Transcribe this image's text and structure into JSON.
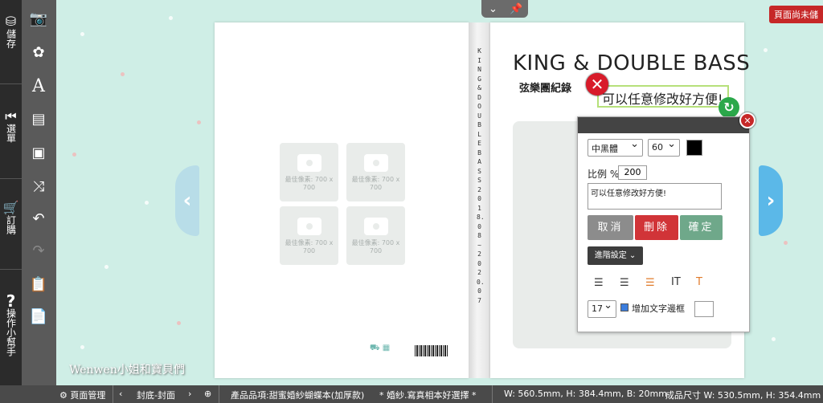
{
  "leftbar": {
    "save": "儲存",
    "menu": "選單",
    "order": "訂購",
    "help": "操作小幫手"
  },
  "toolbar": {
    "icons": [
      "camera-icon",
      "flower-icon",
      "text-icon",
      "layout-icon",
      "add-page-icon",
      "shuffle-icon",
      "undo-icon",
      "redo-icon",
      "paste-icon",
      "clipboard-icon"
    ]
  },
  "topbar": {
    "unsaved_label": "頁面尚未儲"
  },
  "page_left": {
    "photo_hint": "最佳像素: 700 x 700",
    "photo_count": 4
  },
  "spine": {
    "text": "KING & DOUBLE BASS 2018.08~2020.07"
  },
  "page_right": {
    "title": "KING & DOUBLE BASS",
    "subtitle": "弦樂團紀錄",
    "selected_text": "可以任意修改好方便!"
  },
  "panel": {
    "font": "中黑體",
    "size": "60",
    "scale_label": "比例 %",
    "scale_value": "200",
    "text_value": "可以任意修改好方便!",
    "cancel": "取消",
    "delete": "刪除",
    "confirm": "確定",
    "advanced": "進階設定",
    "line_size": "17",
    "outline_label": "增加文字邊框",
    "colors": {
      "cancel": "#8c8c8c",
      "delete": "#d13438",
      "confirm": "#6fa88a"
    }
  },
  "statusbar": {
    "page_manage": "頁面管理",
    "page_nav": "封底-封面",
    "product": "產品品項:甜蜜婚紗蝴蝶本(加厚款)",
    "note": "* 婚紗.寫真相本好選擇 *",
    "size": "W: 560.5mm, H: 384.4mm, B: 20mm",
    "final_size": "成品尺寸 W: 530.5mm, H: 354.4mm"
  },
  "watermark": "Wenwen小姐和寶貝們"
}
